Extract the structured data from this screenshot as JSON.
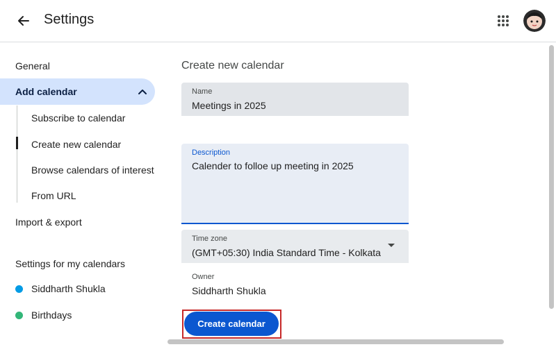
{
  "header": {
    "title": "Settings",
    "back_icon": "arrow-left-icon",
    "apps_icon": "grid-apps-icon",
    "avatar_icon": "user-avatar"
  },
  "sidebar": {
    "general": "General",
    "add_calendar": "Add calendar",
    "sub_items": [
      "Subscribe to calendar",
      "Create new calendar",
      "Browse calendars of interest",
      "From URL"
    ],
    "import_export": "Import & export",
    "section_title": "Settings for my calendars",
    "calendars": [
      {
        "name": "Siddharth Shukla",
        "color": "#039be5"
      },
      {
        "name": "Birthdays",
        "color": "#33b679"
      }
    ]
  },
  "main": {
    "title": "Create new calendar",
    "name_label": "Name",
    "name_value": "Meetings in 2025",
    "description_label": "Description",
    "description_value": "Calender to folloe up meeting in 2025",
    "timezone_label": "Time zone",
    "timezone_value": "(GMT+05:30) India Standard Time - Kolkata",
    "owner_label": "Owner",
    "owner_value": "Siddharth Shukla",
    "create_button": "Create calendar"
  },
  "colors": {
    "accent": "#0b57d0",
    "nav_active_bg": "#d3e3fd",
    "highlight_frame": "#c62828"
  }
}
